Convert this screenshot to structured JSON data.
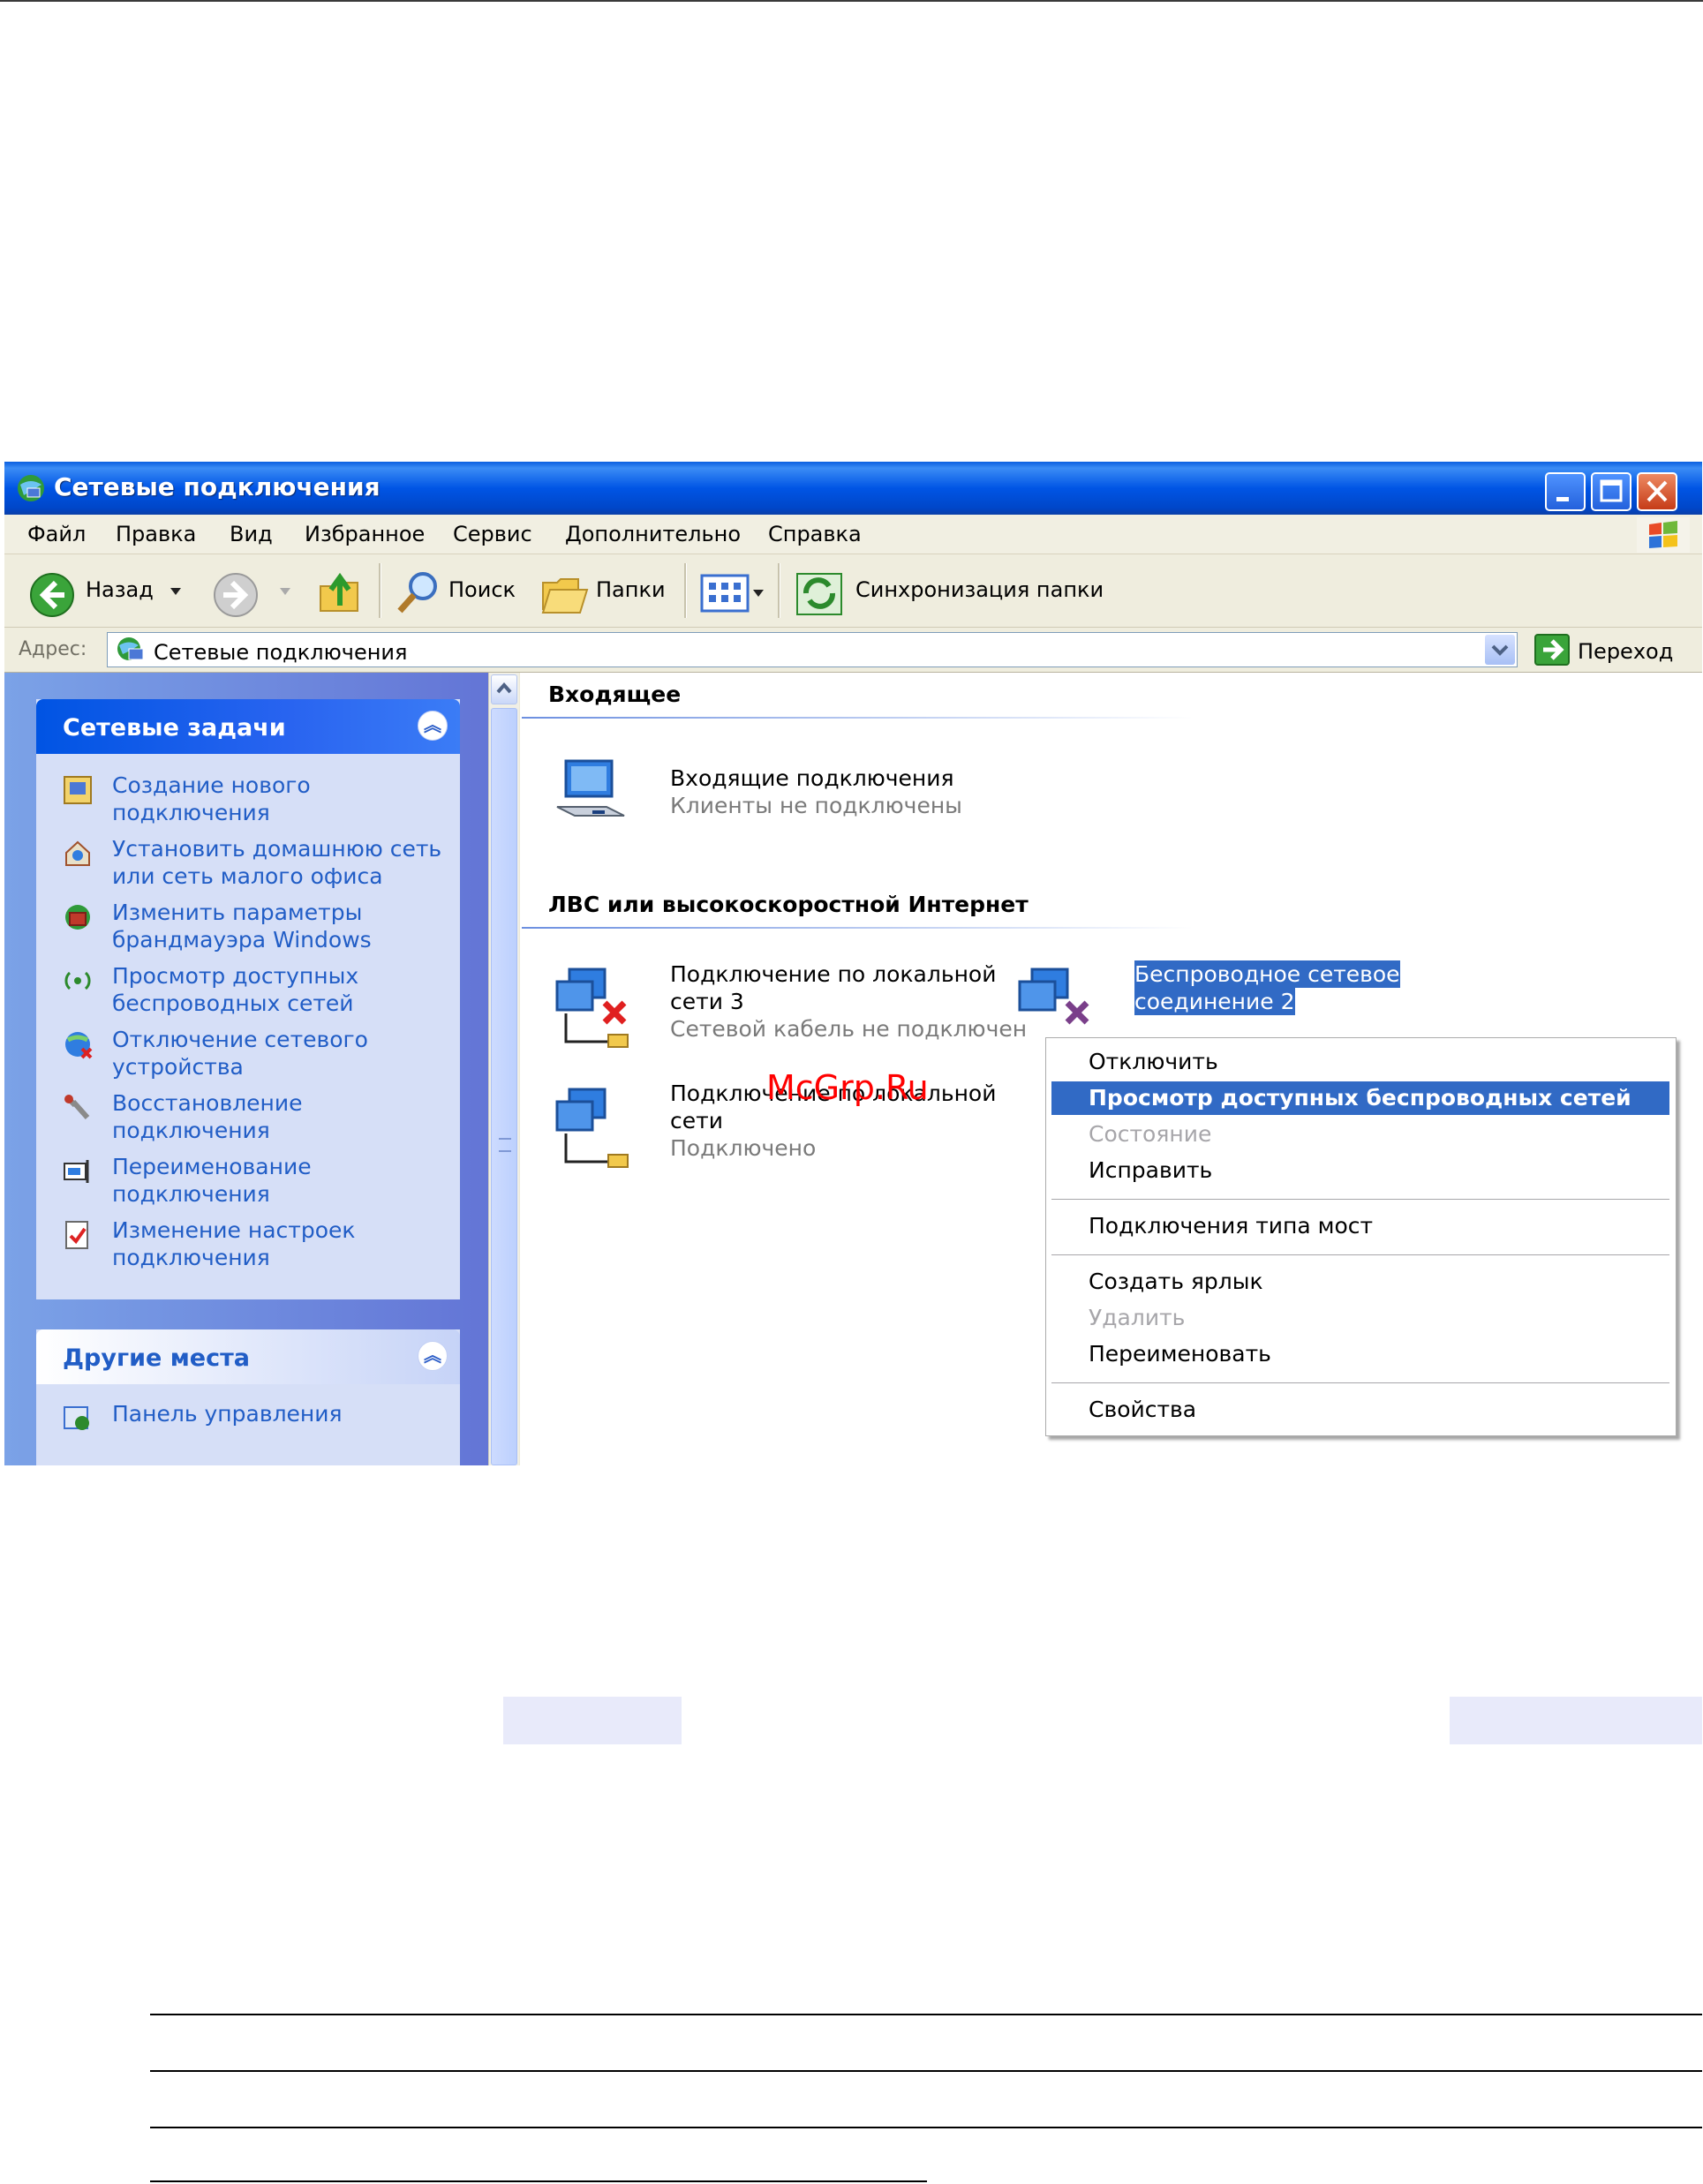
{
  "window": {
    "title": "Сетевые подключения"
  },
  "menubar": {
    "items": [
      "Файл",
      "Правка",
      "Вид",
      "Избранное",
      "Сервис",
      "Дополнительно",
      "Справка"
    ]
  },
  "toolbar": {
    "back_label": "Назад",
    "search_label": "Поиск",
    "folders_label": "Папки",
    "sync_label": "Синхронизация папки"
  },
  "address": {
    "label": "Адрес:",
    "value": "Сетевые подключения",
    "go_label": "Переход"
  },
  "tasks_panel": {
    "title": "Сетевые задачи",
    "items": [
      "Создание нового подключения",
      "Установить домашнюю сеть или сеть малого офиса",
      "Изменить параметры брандмауэра Windows",
      "Просмотр доступных беспроводных сетей",
      "Отключение сетевого устройства",
      "Восстановление подключения",
      "Переименование подключения",
      "Изменение настроек подключения"
    ]
  },
  "places_panel": {
    "title": "Другие места",
    "items": [
      "Панель управления"
    ]
  },
  "content": {
    "group_incoming": "Входящее",
    "incoming": {
      "name": "Входящие подключения",
      "status": "Клиенты не подключены"
    },
    "group_lan": "ЛВС или высокоскоростной Интернет",
    "lan3": {
      "name_line1": "Подключение по локальной",
      "name_line2": "сети 3",
      "status": "Сетевой кабель не подключен"
    },
    "lan": {
      "name_line1": "Подключение по локальной",
      "name_line2": "сети",
      "status": "Подключено"
    },
    "wireless": {
      "name_line1": "Беспроводное сетевое",
      "name_line2": "соединение 2"
    }
  },
  "context_menu": {
    "items": [
      {
        "label": "Отключить",
        "state": "normal"
      },
      {
        "label": "Просмотр доступных беспроводных сетей",
        "state": "highlighted"
      },
      {
        "label": "Состояние",
        "state": "disabled"
      },
      {
        "label": "Исправить",
        "state": "normal"
      },
      {
        "label": "Подключения типа мост",
        "state": "normal"
      },
      {
        "label": "Создать ярлык",
        "state": "normal"
      },
      {
        "label": "Удалить",
        "state": "disabled"
      },
      {
        "label": "Переименовать",
        "state": "normal"
      },
      {
        "label": "Свойства",
        "state": "normal"
      }
    ]
  },
  "watermark": "McGrp.Ru",
  "colors": {
    "titlebar": "#0055e5",
    "selection": "#316ac5",
    "task_link": "#215dc6",
    "watermark": "#ff0000"
  }
}
